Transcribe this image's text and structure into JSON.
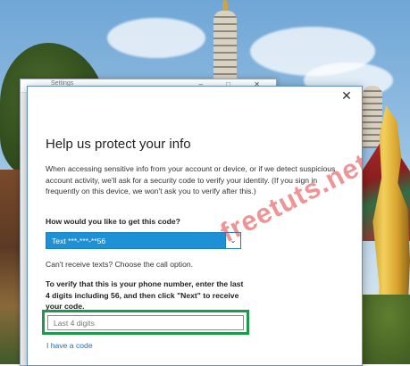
{
  "background_window": {
    "title": "Settings",
    "controls": "–  □  ✕"
  },
  "dialog": {
    "close_label": "✕",
    "heading": "Help us protect your info",
    "intro": "When accessing sensitive info from your account or device, or if we detect suspicious account activity, we'll ask for a security code to verify your identity. (If you sign in frequently on this device, we won't ask you to verify after this.)",
    "question": "How would you like to get this code?",
    "method_select": {
      "value": "Text ***-***-**56",
      "arrow": "⌄"
    },
    "cant_receive": "Can't receive texts? Choose the call option.",
    "verify_instructions": "To verify that this is your phone number, enter the last 4 digits including 56, and then click \"Next\" to receive your code.",
    "digits_input": {
      "value": "",
      "placeholder": "Last 4 digits"
    },
    "have_code_link": "I have a code",
    "highlight_color": "#1a9a4a",
    "select_color": "#1e90d6",
    "link_color": "#1b6fc4"
  },
  "watermark": "freetuts.net"
}
